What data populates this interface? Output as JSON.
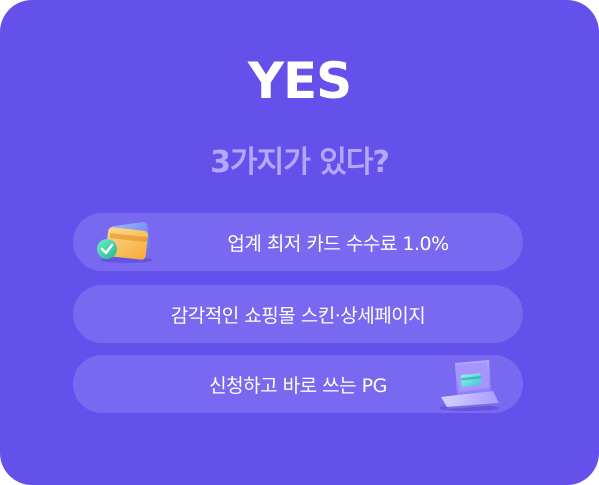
{
  "banner": {
    "title": "YES",
    "subtitle": "3가지가 있다?",
    "items": [
      {
        "label": "업계 최저 카드 수수료 1.0%",
        "icon": "credit-card-check-icon"
      },
      {
        "label": "감각적인 쇼핑몰 스킨·상세페이지"
      },
      {
        "label": "신청하고 바로 쓰는 PG",
        "icon": "laptop-card-icon"
      }
    ]
  },
  "colors": {
    "background": "#6450ea",
    "pill": "#7969f0",
    "subtitle": "#b2a8ff",
    "text": "#ffffff"
  }
}
